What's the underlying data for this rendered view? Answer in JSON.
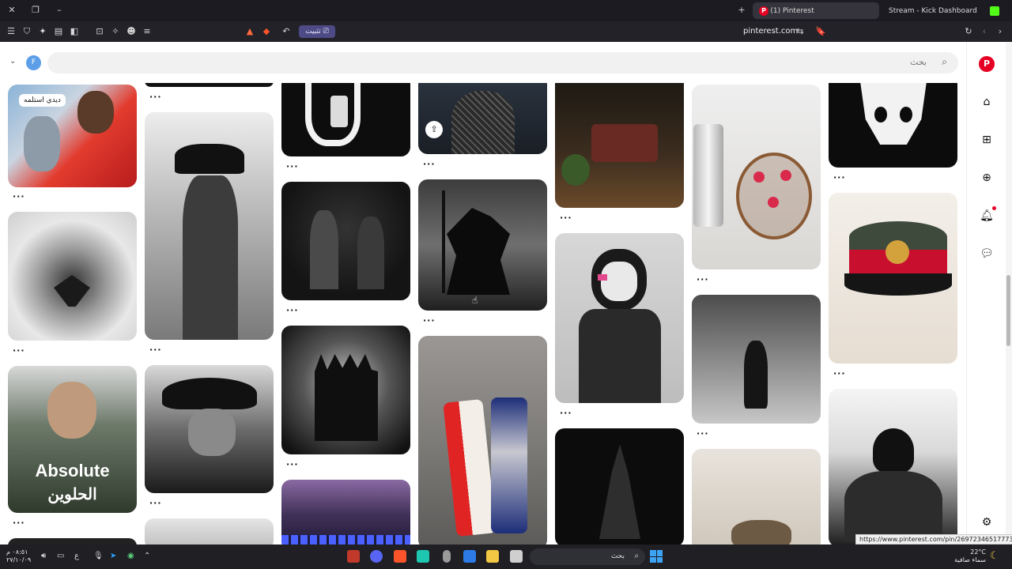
{
  "browser": {
    "tabs": [
      {
        "title": "(1) Pinterest"
      },
      {
        "title": "Stream - Kick Dashboard"
      }
    ],
    "install_label": "تثبيت",
    "url": "pinterest.com",
    "status_link": "https://www.pinterest.com/pin/26972346517773223​5/"
  },
  "header": {
    "search_placeholder": "بحث",
    "avatar_letter": "F",
    "logo_letter": "P"
  },
  "pins": {
    "label_tomjerry": "ديدي استلمه",
    "absolute_line1": "Absolute",
    "absolute_line2": "الحلوين",
    "more": "···"
  },
  "taskbar": {
    "search_label": "بحث",
    "clock_time": "٠٨:٥١ م",
    "clock_date": "٢٧/١٠/٠٩",
    "weather_temp": "22°C",
    "weather_desc": "سماء صافية",
    "lang": "ع"
  },
  "colors": {
    "pinterest_red": "#e60023",
    "tab_bar": "#1c1b22",
    "install_pill": "#4d4a85"
  }
}
